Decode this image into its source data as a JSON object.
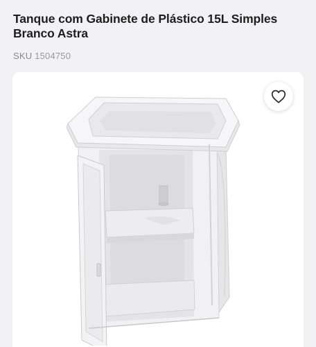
{
  "product": {
    "title": "Tanque com Gabinete de Plástico 15L Simples Branco Astra",
    "sku_label": "SKU",
    "sku_value": "1504750"
  },
  "icons": {
    "favorite": "heart-outline-icon"
  },
  "colors": {
    "title_text": "#1e1e1e",
    "sku_text": "#8a8a8e",
    "page_background": "#f2f2f4",
    "card_background": "#ffffff"
  }
}
